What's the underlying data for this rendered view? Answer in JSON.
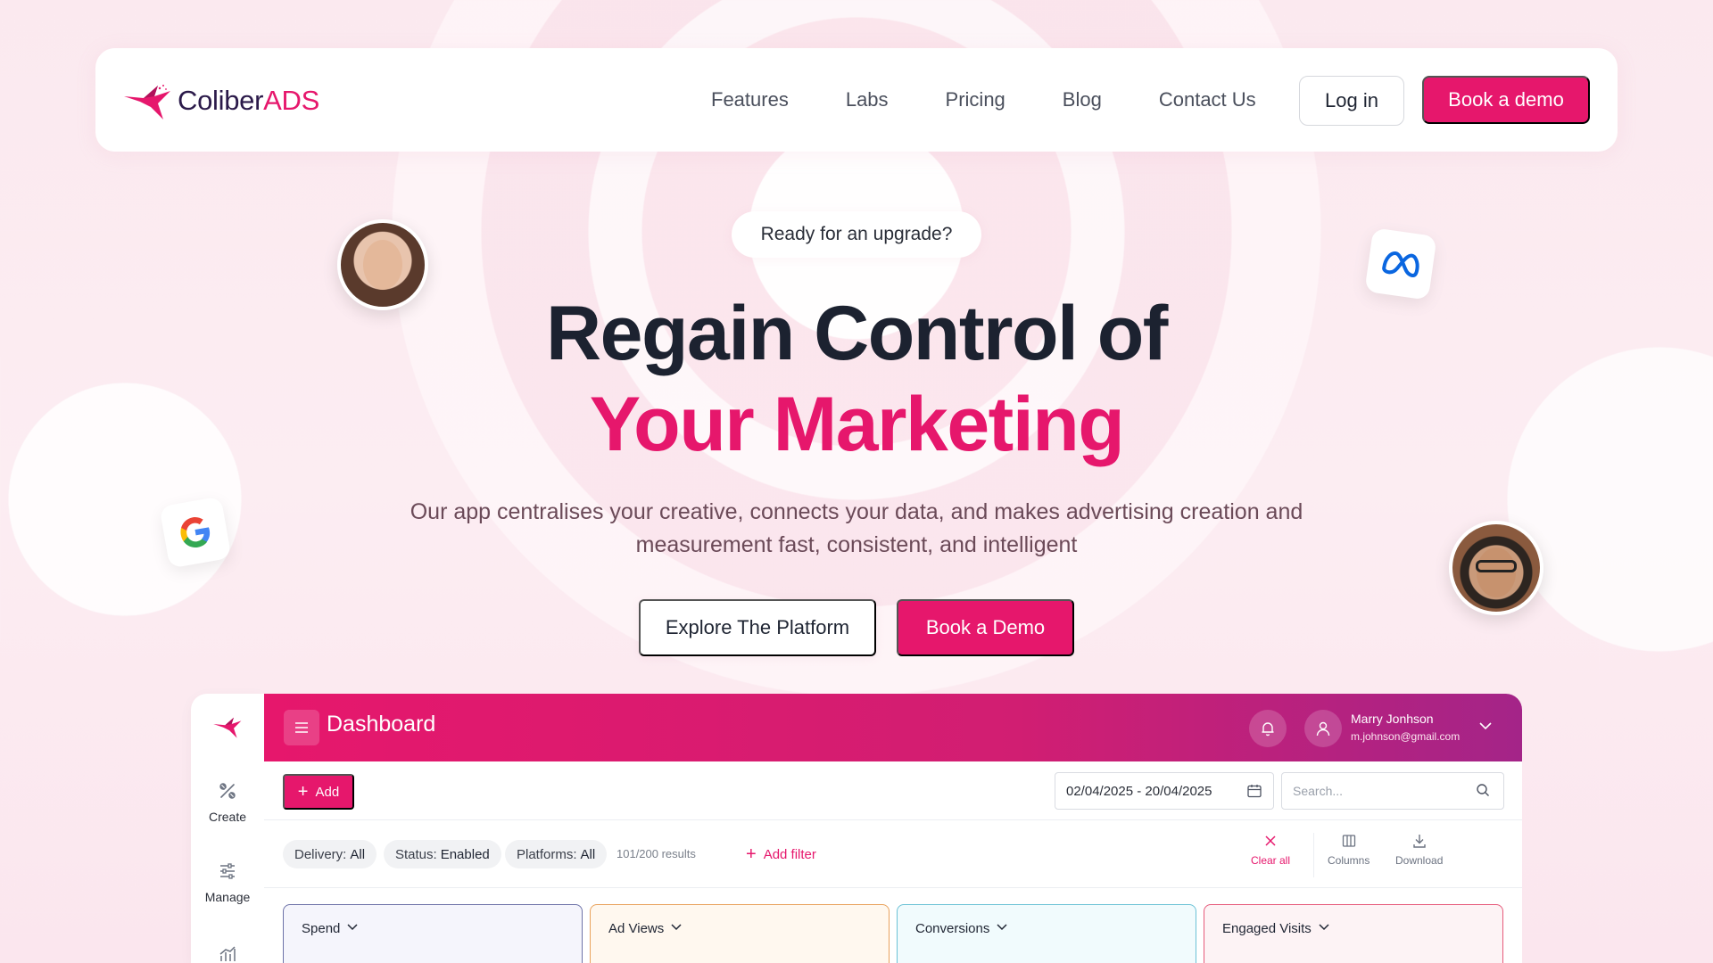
{
  "brand": {
    "name_part1": "Coliber",
    "name_part2": "ADS",
    "accent": "#e6176c"
  },
  "nav": {
    "links": [
      "Features",
      "Labs",
      "Pricing",
      "Blog",
      "Contact Us"
    ],
    "login": "Log in",
    "demo": "Book a demo"
  },
  "hero": {
    "pill": "Ready for an upgrade?",
    "title_line1": "Regain Control of",
    "title_line2": "Your Marketing",
    "subtitle": "Our app centralises your creative, connects your data, and makes advertising creation and measurement fast, consistent, and intelligent",
    "explore_button": "Explore The Platform",
    "demo_button": "Book a Demo"
  },
  "icons": {
    "google": "google-logo-icon",
    "meta": "meta-logo-icon"
  },
  "dashboard": {
    "sidebar": [
      {
        "label": "Create",
        "icon": "create-icon"
      },
      {
        "label": "Manage",
        "icon": "manage-sliders-icon"
      },
      {
        "label": "",
        "icon": "analytics-icon"
      }
    ],
    "title": "Dashboard",
    "user": {
      "name": "Marry Jonhson",
      "email": "m.johnson@gmail.com"
    },
    "add_button": "Add",
    "date_range": "02/04/2025 - 20/04/2025",
    "search_placeholder": "Search...",
    "filters": [
      {
        "key": "Delivery:",
        "value": "All"
      },
      {
        "key": "Status:",
        "value": "Enabled"
      },
      {
        "key": "Platforms:",
        "value": "All"
      }
    ],
    "results": "101/200 results",
    "add_filter": "Add filter",
    "tools": [
      "Clear all",
      "Columns",
      "Download"
    ],
    "metric_cards": [
      {
        "label": "Spend",
        "color": "#6d72a8",
        "bg": "#f5f5fc"
      },
      {
        "label": "Ad Views",
        "color": "#e9a25c",
        "bg": "#fff8ef"
      },
      {
        "label": "Conversions",
        "color": "#6cc2d6",
        "bg": "#f1fbfd"
      },
      {
        "label": "Engaged Visits",
        "color": "#e65a7b",
        "bg": "#fdf3f5"
      }
    ]
  }
}
